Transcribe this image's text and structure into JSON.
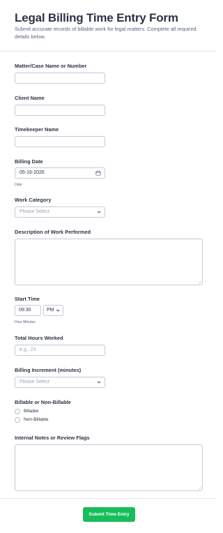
{
  "form": {
    "title": "Legal Billing Time Entry Form",
    "subtitle": "Submit accurate records of billable work for legal matters. Complete all required details below."
  },
  "fields": {
    "matter": {
      "label": "Matter/Case Name or Number",
      "value": ""
    },
    "client": {
      "label": "Client Name",
      "value": ""
    },
    "timekeeper": {
      "label": "Timekeeper Name",
      "value": ""
    },
    "billing_date": {
      "label": "Billing Date",
      "value": "05-16-2026",
      "sublabel": "Date",
      "icon": "calendar-icon"
    },
    "work_category": {
      "label": "Work Category",
      "placeholder": "Please Select",
      "icon": "chevron-down-icon"
    },
    "description": {
      "label": "Description of Work Performed",
      "value": ""
    },
    "start_time": {
      "label": "Start Time",
      "time_value": "09:30",
      "ampm_value": "PM",
      "sublabel": "Hour Minutes"
    },
    "total_hours": {
      "label": "Total Hours Worked",
      "placeholder": "e.g., 23"
    },
    "billing_increment": {
      "label": "Billing Increment (minutes)",
      "placeholder": "Please Select"
    },
    "billable": {
      "label": "Billable or Non-Billable",
      "options": [
        "Billable",
        "Non-Billable"
      ]
    },
    "internal_notes": {
      "label": "Internal Notes or Review Flags",
      "value": ""
    }
  },
  "footer": {
    "submit_label": "Submit Time Entry"
  },
  "colors": {
    "accent": "#18bd5b",
    "text": "#2c3345",
    "border": "#c3cad8"
  }
}
